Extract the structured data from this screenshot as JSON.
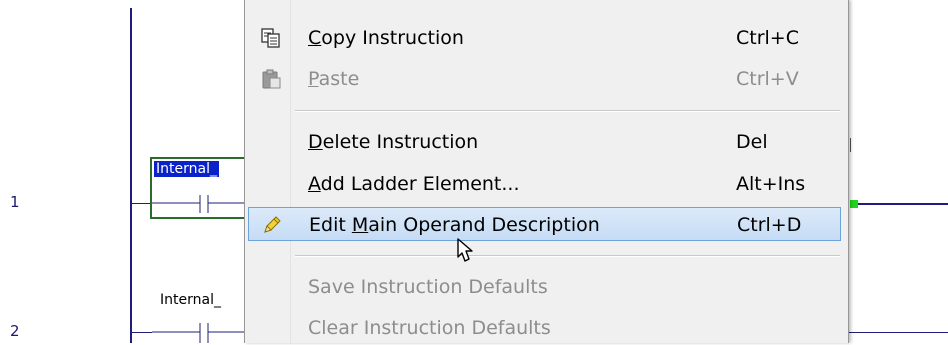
{
  "rungs": [
    {
      "number": "1",
      "tag": "Internal_"
    },
    {
      "number": "2",
      "tag": "Internal_"
    }
  ],
  "context_menu": {
    "items": [
      {
        "pre": "",
        "accel": "C",
        "post": "opy Instruction",
        "shortcut": "Ctrl+C",
        "icon": "copy-icon",
        "enabled": true
      },
      {
        "pre": "",
        "accel": "P",
        "post": "aste",
        "shortcut": "Ctrl+V",
        "icon": "paste-icon",
        "enabled": false
      },
      {
        "pre": "",
        "accel": "D",
        "post": "elete Instruction",
        "shortcut": "Del",
        "icon": "",
        "enabled": true
      },
      {
        "pre": "",
        "accel": "A",
        "post": "dd Ladder Element...",
        "shortcut": "Alt+Ins",
        "icon": "",
        "enabled": true
      },
      {
        "pre": "Edit ",
        "accel": "M",
        "post": "ain Operand Description",
        "shortcut": "Ctrl+D",
        "icon": "pencil-icon",
        "enabled": true,
        "highlighted": true
      },
      {
        "pre": "Save Instruction Defaults",
        "accel": "",
        "post": "",
        "shortcut": "",
        "icon": "",
        "enabled": false
      },
      {
        "pre": "Clear Instruction Defaults",
        "accel": "",
        "post": "",
        "shortcut": "",
        "icon": "",
        "enabled": false
      }
    ]
  },
  "colors": {
    "rail": "#1f1f7a",
    "selection_green": "#2b6b2b",
    "energized_marker": "#1fd31f",
    "tag_selected_bg": "#0b22c9",
    "menu_highlight_border": "#6da3db"
  }
}
